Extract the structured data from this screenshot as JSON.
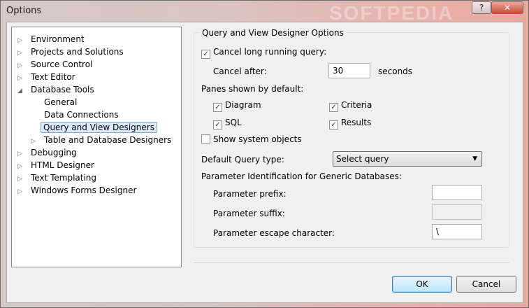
{
  "window": {
    "title": "Options",
    "watermark": "SOFTPEDIA",
    "help_label": "?",
    "close_label": "✕"
  },
  "tree": {
    "items": [
      {
        "label": "Environment",
        "expander": "▷"
      },
      {
        "label": "Projects and Solutions",
        "expander": "▷"
      },
      {
        "label": "Source Control",
        "expander": "▷"
      },
      {
        "label": "Text Editor",
        "expander": "▷"
      },
      {
        "label": "Database Tools",
        "expander": "◢"
      },
      {
        "label": "General",
        "expander": ""
      },
      {
        "label": "Data Connections",
        "expander": ""
      },
      {
        "label": "Query and View Designers",
        "expander": ""
      },
      {
        "label": "Table and Database Designers",
        "expander": "▷"
      },
      {
        "label": "Debugging",
        "expander": "▷"
      },
      {
        "label": "HTML Designer",
        "expander": "▷"
      },
      {
        "label": "Text Templating",
        "expander": "▷"
      },
      {
        "label": "Windows Forms Designer",
        "expander": "▷"
      }
    ],
    "selected": "Query and View Designers"
  },
  "options": {
    "group_title": "Query and View Designer Options",
    "cancel_long_query": {
      "label": "Cancel long running query:",
      "checked": true
    },
    "cancel_after_label": "Cancel after:",
    "cancel_after_value": "30",
    "seconds_label": "seconds",
    "panes_label": "Panes shown by default:",
    "panes": {
      "diagram": {
        "label": "Diagram",
        "checked": true
      },
      "criteria": {
        "label": "Criteria",
        "checked": true
      },
      "sql": {
        "label": "SQL",
        "checked": true
      },
      "results": {
        "label": "Results",
        "checked": true
      }
    },
    "show_system_objects": {
      "label": "Show system objects",
      "checked": false
    },
    "query_type_label": "Default Query type:",
    "query_type_value": "Select query",
    "param_id_label": "Parameter Identification for Generic Databases:",
    "param_prefix_label": "Parameter prefix:",
    "param_prefix_value": "",
    "param_suffix_label": "Parameter suffix:",
    "param_suffix_value": "",
    "param_escape_label": "Parameter escape character:",
    "param_escape_value": "\\"
  },
  "buttons": {
    "ok": "OK",
    "cancel": "Cancel"
  },
  "check_glyph": "✓"
}
